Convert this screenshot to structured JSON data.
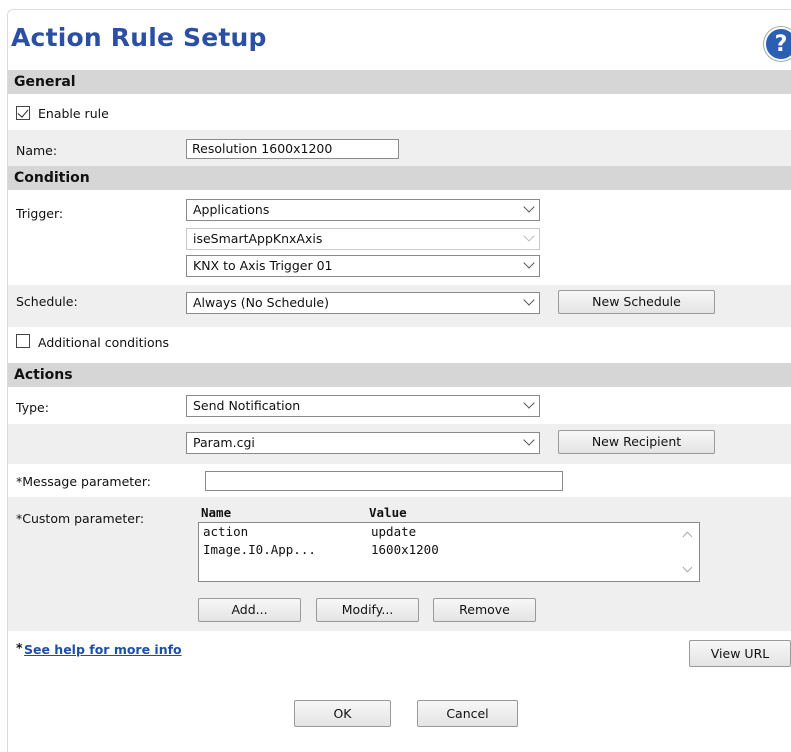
{
  "header": {
    "title": "Action Rule Setup",
    "help_glyph": "?"
  },
  "general": {
    "section_label": "General",
    "enable_rule_label": "Enable rule",
    "enable_rule_checked": true,
    "name_label": "Name:",
    "name_value": "Resolution 1600x1200"
  },
  "condition": {
    "section_label": "Condition",
    "trigger_label": "Trigger:",
    "trigger_value": "Applications",
    "trigger_app_value": "iseSmartAppKnxAxis",
    "trigger_event_value": "KNX to Axis Trigger 01",
    "schedule_label": "Schedule:",
    "schedule_value": "Always (No Schedule)",
    "new_schedule_label": "New Schedule",
    "additional_conditions_label": "Additional conditions",
    "additional_conditions_checked": false
  },
  "actions": {
    "section_label": "Actions",
    "type_label": "Type:",
    "type_value": "Send Notification",
    "recipient_value": "Param.cgi",
    "new_recipient_label": "New Recipient",
    "message_param_label": "*Message parameter:",
    "message_param_value": "",
    "custom_param_label": "*Custom parameter:",
    "table": {
      "headers": [
        "Name",
        "Value"
      ],
      "rows": [
        {
          "name": "action",
          "value": "update"
        },
        {
          "name": "Image.I0.App...",
          "value": "1600x1200"
        }
      ]
    },
    "add_label": "Add...",
    "modify_label": "Modify...",
    "remove_label": "Remove"
  },
  "footer": {
    "help_prefix": "*",
    "help_link": "See help for more info",
    "view_url_label": "View URL",
    "ok_label": "OK",
    "cancel_label": "Cancel"
  }
}
